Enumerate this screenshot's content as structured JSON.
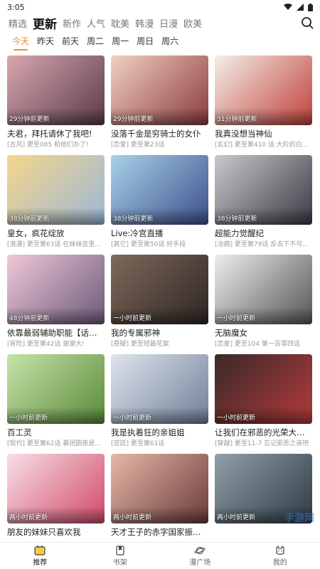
{
  "status": {
    "time": "3:05"
  },
  "top_tabs": [
    {
      "label": "精选",
      "active": false
    },
    {
      "label": "更新",
      "active": true
    },
    {
      "label": "新作",
      "active": false
    },
    {
      "label": "人气",
      "active": false
    },
    {
      "label": "耽美",
      "active": false
    },
    {
      "label": "韩漫",
      "active": false
    },
    {
      "label": "日漫",
      "active": false
    },
    {
      "label": "欧美",
      "active": false
    }
  ],
  "days": [
    {
      "label": "今天",
      "active": true
    },
    {
      "label": "昨天",
      "active": false
    },
    {
      "label": "前天",
      "active": false
    },
    {
      "label": "周二",
      "active": false
    },
    {
      "label": "周一",
      "active": false
    },
    {
      "label": "周日",
      "active": false
    },
    {
      "label": "周六",
      "active": false
    }
  ],
  "comics": [
    {
      "title": "夫君，拜托请休了我吧!",
      "sub": "[古风] 更至085 和他们办了!",
      "update": "29分钟前更新",
      "color1": "#d8a7b0",
      "color2": "#5a3b48"
    },
    {
      "title": "没落千金是穷骑士的女仆",
      "sub": "[恋爱] 更至第23话",
      "update": "29分钟前更新",
      "color1": "#f2d0c2",
      "color2": "#8a3b3b"
    },
    {
      "title": "我真没想当神仙",
      "sub": "[玄幻] 更至第410 话 大阶的白骨精",
      "update": "31分钟前更新",
      "color1": "#f4efe8",
      "color2": "#c0403a"
    },
    {
      "title": "皇女，疯花绽放",
      "sub": "[浪漫] 更至第63话 在妹妹宫里蹭饭",
      "update": "38分钟前更新",
      "color1": "#f5d68a",
      "color2": "#9bb8d8"
    },
    {
      "title": "Live:冷宫直播",
      "sub": "[其它] 更至第50话 好手段",
      "update": "38分钟前更新",
      "color1": "#a9d2e8",
      "color2": "#3d4f8c"
    },
    {
      "title": "超能力觉醒纪",
      "sub": "[冶病] 更至第79话 反击下不可能的",
      "update": "38分钟前更新",
      "color1": "#c9c9cc",
      "color2": "#3a3a44"
    },
    {
      "title": "依靠最弱辅助职能【话术士...",
      "sub": "[冒险] 更至第42话 谢谢大!",
      "update": "48分钟前更新",
      "color1": "#f0c8d8",
      "color2": "#6b5a7a"
    },
    {
      "title": "我的专属邪神",
      "sub": "[悬疑] 更至短篇花絮",
      "update": "一小时前更新",
      "color1": "#7f6a5c",
      "color2": "#2e2522"
    },
    {
      "title": "无脑魔女",
      "sub": "[恋爱] 更至104 第一百零四话",
      "update": "一小时前更新",
      "color1": "#eeeeee",
      "color2": "#555555"
    },
    {
      "title": "百工灵",
      "sub": "[现代] 更至第62话 暴团圆夜是中秋",
      "update": "一小时前更新",
      "color1": "#c6e3a8",
      "color2": "#5a8a3a"
    },
    {
      "title": "我是执着狂的亲姐姐",
      "sub": "[宫廷] 更至第61话",
      "update": "一小时前更新",
      "color1": "#dfe5ee",
      "color2": "#6f7f98"
    },
    {
      "title": "让我们在邪恶的光荣大道上...",
      "sub": "[穿越] 更至11-7 忘记邪恶之道吧",
      "update": "一小时前更新",
      "color1": "#3a2a2a",
      "color2": "#b23a3a"
    },
    {
      "title": "朋友的妹妹只喜欢我",
      "sub": "",
      "update": "两小时前更新",
      "color1": "#f7e0e6",
      "color2": "#d14a6a"
    },
    {
      "title": "天才王子的赤字国家振兴术",
      "sub": "",
      "update": "两小时前更新",
      "color1": "#e7b9a8",
      "color2": "#6a3a3a"
    },
    {
      "title": "",
      "sub": "",
      "update": "两小时前更新",
      "color1": "#8fa0a8",
      "color2": "#2f3a44"
    }
  ],
  "watermark": "手游网",
  "bottom_nav": [
    {
      "label": "推荐",
      "icon": "recommend-icon",
      "active": true
    },
    {
      "label": "书架",
      "icon": "bookshelf-icon",
      "active": false
    },
    {
      "label": "漫广场",
      "icon": "planet-icon",
      "active": false
    },
    {
      "label": "我的",
      "icon": "profile-icon",
      "active": false
    }
  ],
  "colors": {
    "accent": "#f08a2e"
  }
}
